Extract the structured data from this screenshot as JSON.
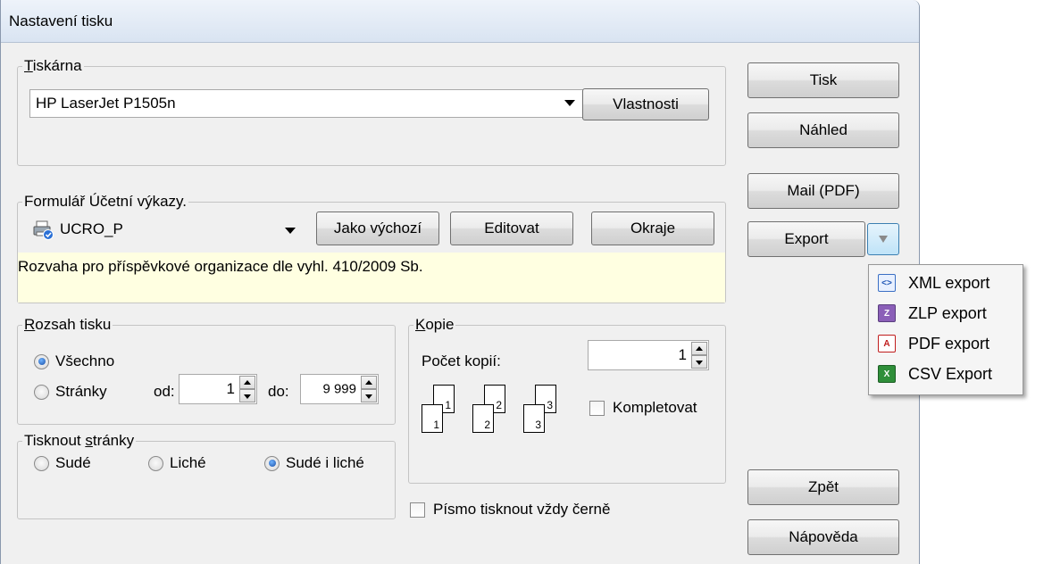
{
  "window": {
    "title": "Nastavení tisku"
  },
  "printer_group": {
    "legend_pre": "",
    "legend_key": "T",
    "legend_post": "iskárna",
    "printer_value": "HP LaserJet P1505n",
    "properties_label": "Vlastnosti"
  },
  "form_group": {
    "legend": "Formulář  Účetní výkazy.",
    "form_value": "UCRO_P",
    "default_label": "Jako výchozí",
    "edit_label": "Editovat",
    "margins_label": "Okraje",
    "description": "Rozvaha pro příspěvkové organizace dle vyhl. 410/2009 Sb."
  },
  "range_group": {
    "legend_key": "R",
    "legend_post": "ozsah tisku",
    "all_label": "Všechno",
    "pages_label": "Stránky",
    "from_label": "od:",
    "from_value": "1",
    "to_label": "do:",
    "to_value": "9 999",
    "selected": "all"
  },
  "print_pages_group": {
    "legend_pre": "Tisknout ",
    "legend_key": "s",
    "legend_post": "tránky",
    "even_label": "Sudé",
    "odd_label": "Liché",
    "both_label": "Sudé i liché",
    "selected": "both"
  },
  "copies_group": {
    "legend_key": "K",
    "legend_post": "opie",
    "count_label": "Počet kopií:",
    "count_value": "1",
    "collate_label": "Kompletovat",
    "collate_checked": false,
    "illustration_pages": [
      "1",
      "1",
      "2",
      "2",
      "3",
      "3"
    ]
  },
  "black_font_label": "Písmo tisknout vždy černě",
  "black_font_checked": false,
  "side_buttons": {
    "print": "Tisk",
    "preview": "Náhled",
    "mail": "Mail (PDF)",
    "export": "Export",
    "back": "Zpět",
    "help": "Nápověda"
  },
  "export_menu": {
    "items": [
      {
        "label": "XML export",
        "icon": "xml-file-icon"
      },
      {
        "label": "ZLP export",
        "icon": "zlp-file-icon"
      },
      {
        "label": "PDF export",
        "icon": "pdf-file-icon"
      },
      {
        "label": "CSV Export",
        "icon": "csv-file-icon"
      }
    ]
  },
  "colors": {
    "description_bg": "#ffffe1",
    "window_bg": "#f0f0f0",
    "titlebar_bg": "#dee7f4"
  }
}
